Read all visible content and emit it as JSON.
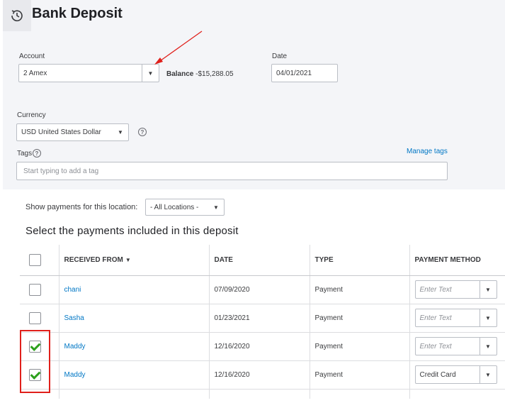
{
  "header": {
    "title": "Bank Deposit",
    "history_icon": "history-clock-icon"
  },
  "account": {
    "label": "Account",
    "value": "2 Amex",
    "balance_label": "Balance",
    "balance_value": "-$15,288.05"
  },
  "date": {
    "label": "Date",
    "value": "04/01/2021"
  },
  "currency": {
    "label": "Currency",
    "value": "USD United States Dollar",
    "help_glyph": "?"
  },
  "tags": {
    "label": "Tags",
    "help_glyph": "?",
    "manage_link": "Manage tags",
    "placeholder": "Start typing to add a tag"
  },
  "location_filter": {
    "label": "Show payments for this location:",
    "value": "- All Locations -"
  },
  "payments": {
    "title": "Select the payments included in this deposit",
    "columns": [
      "RECEIVED FROM",
      "DATE",
      "TYPE",
      "PAYMENT METHOD"
    ],
    "rows": [
      {
        "checked": false,
        "received_from": "chani",
        "date": "07/09/2020",
        "type": "Payment",
        "method": "",
        "method_placeholder": "Enter Text"
      },
      {
        "checked": false,
        "received_from": "Sasha",
        "date": "01/23/2021",
        "type": "Payment",
        "method": "",
        "method_placeholder": "Enter Text"
      },
      {
        "checked": true,
        "received_from": "Maddy",
        "date": "12/16/2020",
        "type": "Payment",
        "method": "",
        "method_placeholder": "Enter Text"
      },
      {
        "checked": true,
        "received_from": "Maddy",
        "date": "12/16/2020",
        "type": "Payment",
        "method": "Credit Card",
        "method_placeholder": ""
      }
    ]
  },
  "colors": {
    "accent_link": "#0077c5",
    "check_green": "#2ca01c",
    "annotation_red": "#e0201b",
    "panel_bg": "#f4f5f8"
  }
}
